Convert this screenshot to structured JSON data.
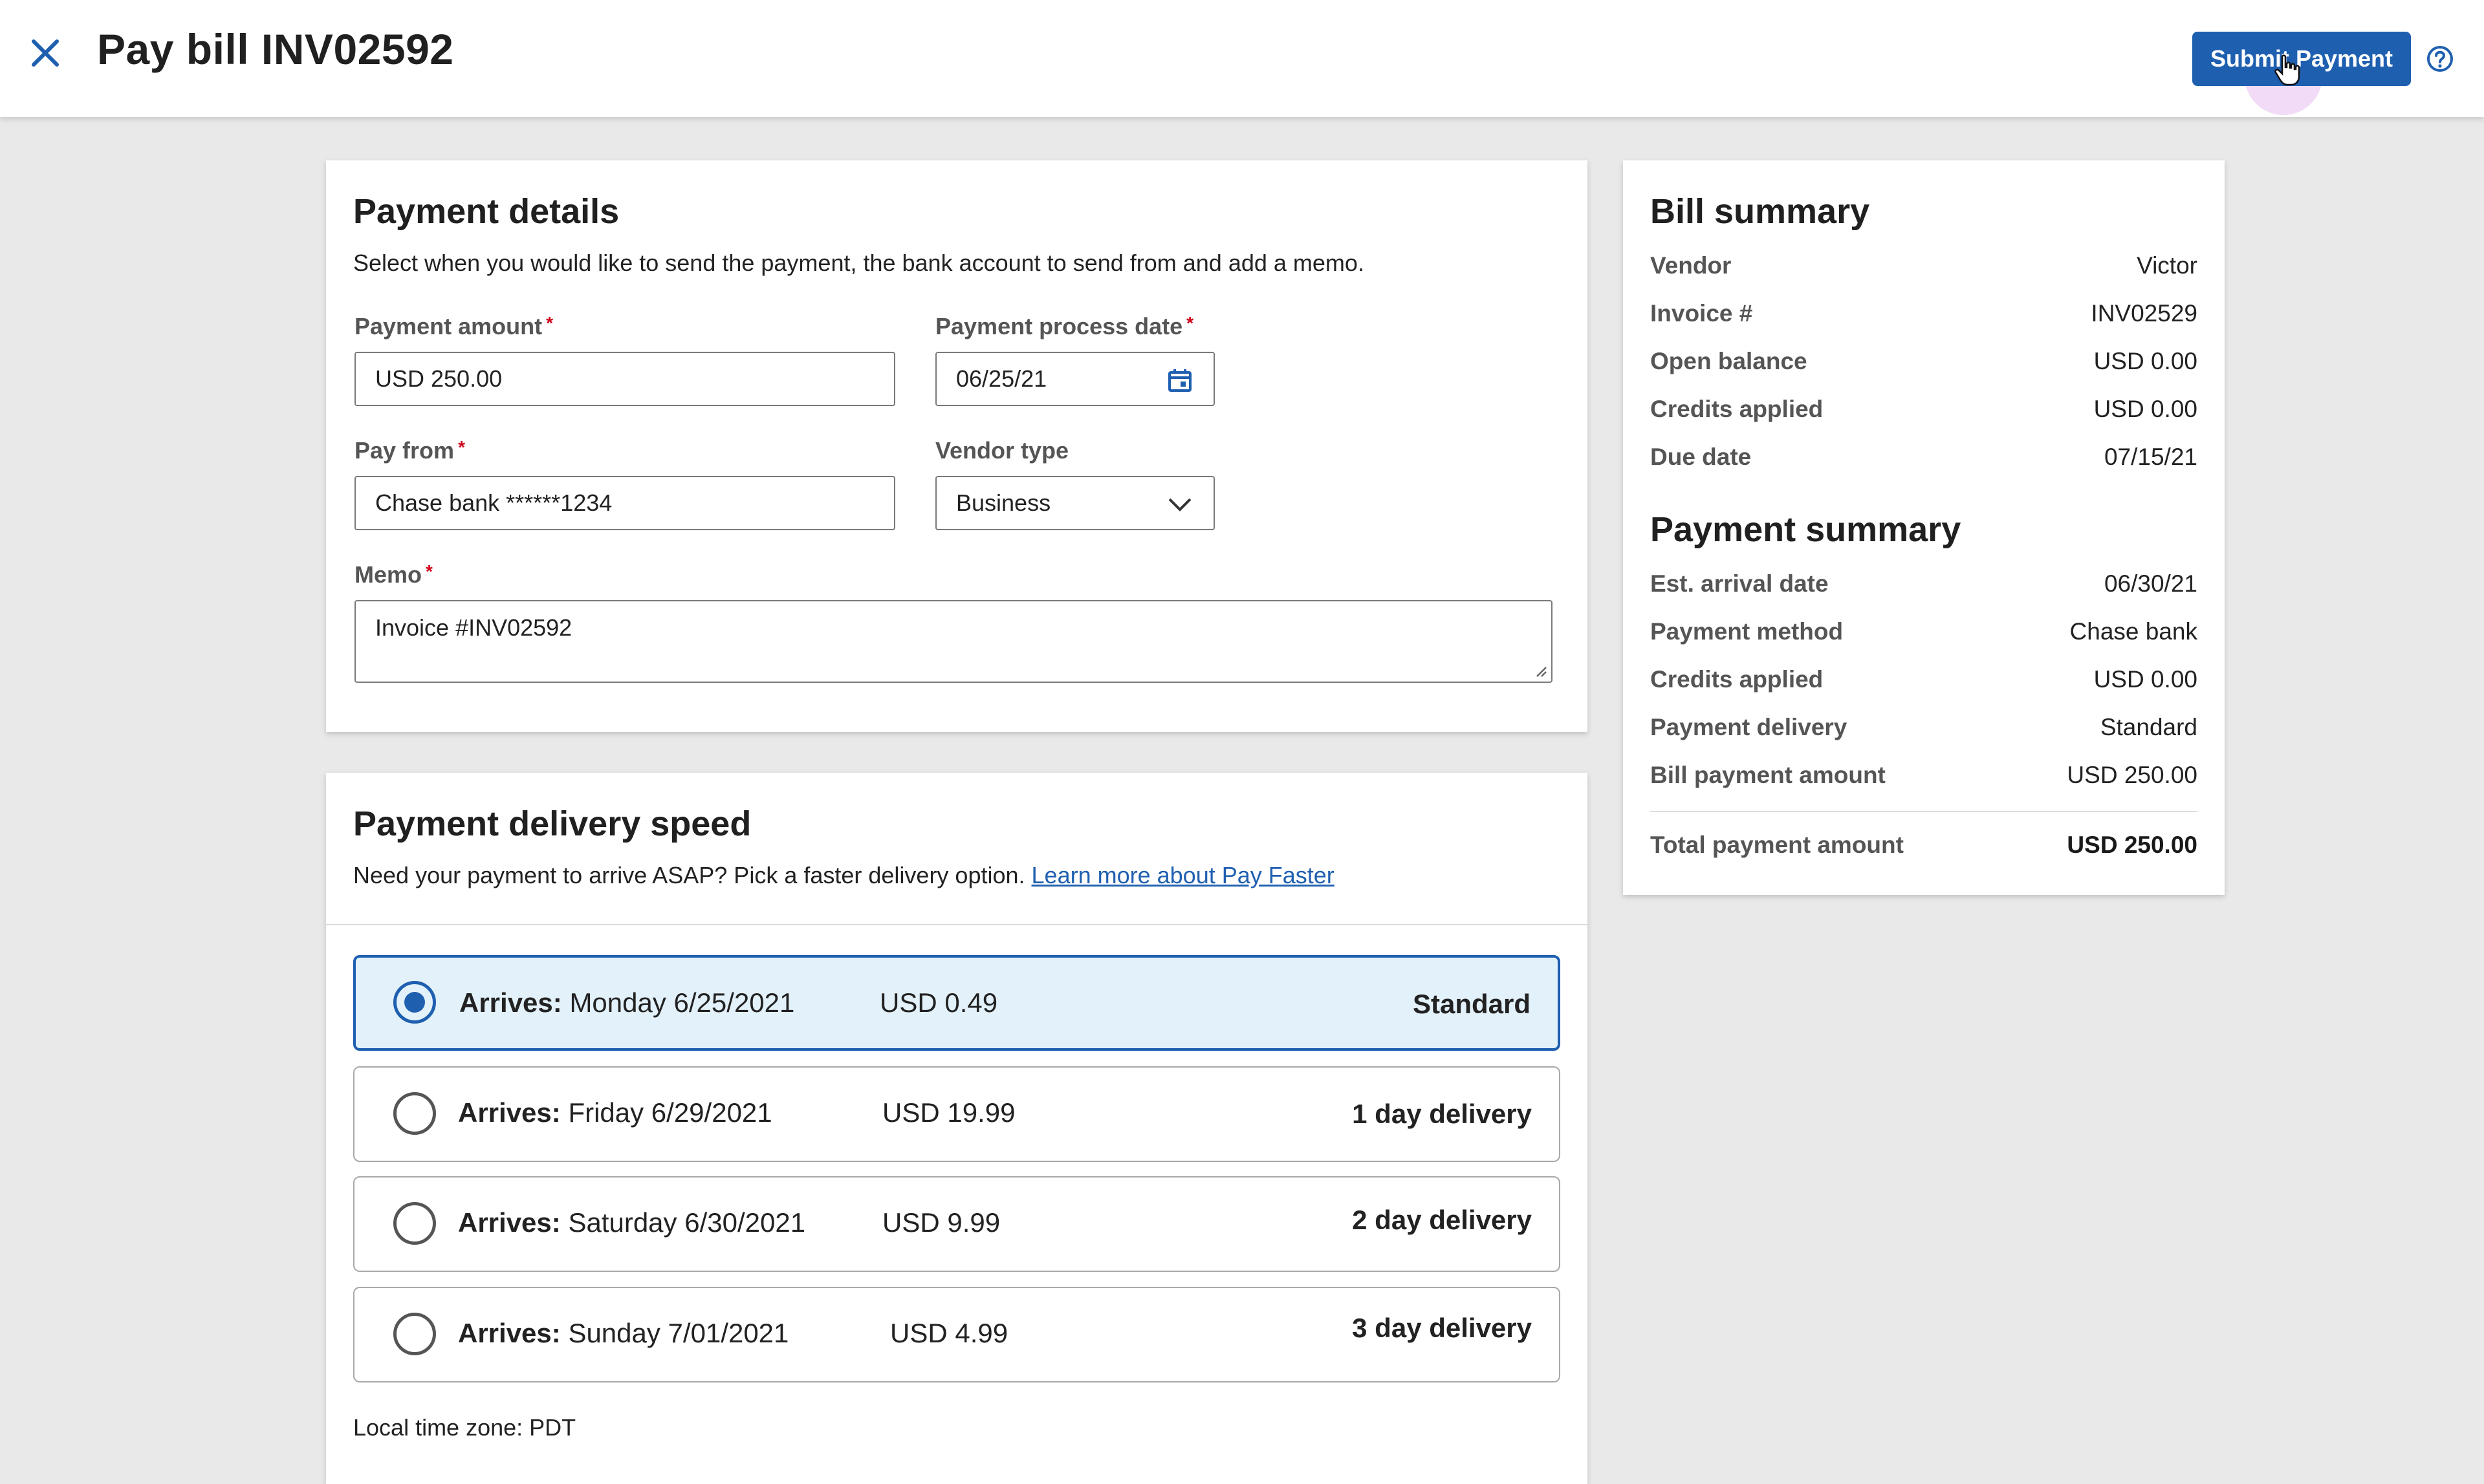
{
  "header": {
    "title": "Pay bill INV02592",
    "submit_label": "Submit Payment",
    "icons": [
      "close-icon",
      "help-icon",
      "hand-cursor-icon"
    ],
    "accent_color": "#1f5fb0"
  },
  "payment_details": {
    "title": "Payment details",
    "subtitle": "Select when you would like to send the payment, the bank account to send from and add a memo.",
    "amount_label": "Payment amount",
    "amount_value": "USD 250.00",
    "date_label": "Payment process date",
    "date_value": "06/25/21",
    "pay_from_label": "Pay from",
    "pay_from_value": "Chase bank ******1234",
    "vendor_type_label": "Vendor type",
    "vendor_type_value": "Business",
    "memo_label": "Memo",
    "memo_value": "Invoice #INV02592",
    "required_mark": "*"
  },
  "delivery": {
    "title": "Payment delivery speed",
    "subtitle": "Need your payment to arrive ASAP? Pick a faster delivery option.",
    "link_label": "Learn more about Pay Faster",
    "arrives_label": "Arrives:",
    "options": [
      {
        "date": "Monday 6/25/2021",
        "price": "USD 0.49",
        "speed": "Standard",
        "selected": true
      },
      {
        "date": "Friday 6/29/2021",
        "price": "USD 19.99",
        "speed": "1 day delivery",
        "selected": false
      },
      {
        "date": "Saturday 6/30/2021",
        "price": "USD 9.99",
        "speed": "2 day delivery",
        "selected": false
      },
      {
        "date": "Sunday 7/01/2021",
        "price": "USD 4.99",
        "speed": "3 day delivery",
        "selected": false
      }
    ],
    "timezone": "Local time zone: PDT"
  },
  "bill_summary": {
    "title": "Bill summary",
    "rows": [
      {
        "label": "Vendor",
        "value": "Victor"
      },
      {
        "label": "Invoice #",
        "value": "INV02529"
      },
      {
        "label": "Open balance",
        "value": "USD 0.00"
      },
      {
        "label": "Credits applied",
        "value": "USD 0.00"
      },
      {
        "label": "Due date",
        "value": "07/15/21"
      }
    ]
  },
  "payment_summary": {
    "title": "Payment summary",
    "rows": [
      {
        "label": "Est. arrival date",
        "value": "06/30/21"
      },
      {
        "label": "Payment method",
        "value": "Chase bank"
      },
      {
        "label": "Credits applied",
        "value": "USD 0.00"
      },
      {
        "label": "Payment delivery",
        "value": "Standard"
      },
      {
        "label": "Bill payment amount",
        "value": "USD 250.00"
      }
    ],
    "total_label": "Total payment amount",
    "total_value": "USD 250.00"
  }
}
